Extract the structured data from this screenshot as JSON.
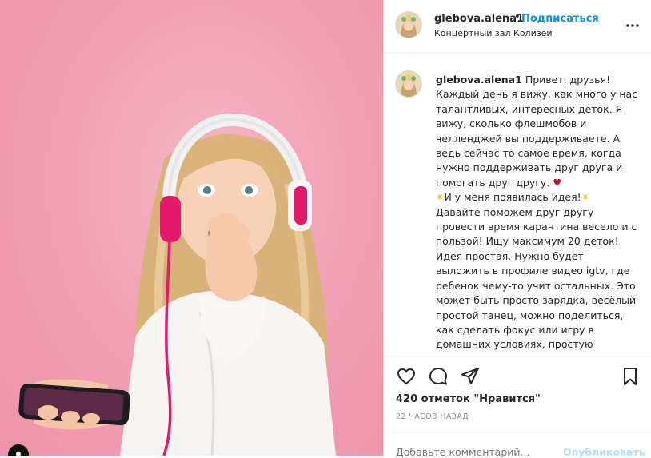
{
  "header": {
    "username": "glebova.alena1",
    "separator": "•",
    "follow_label": "Подписаться",
    "location": "Концертный зал Колизей",
    "more_icon": "more-horizontal-icon"
  },
  "caption": {
    "username": "glebova.alena1",
    "intro": "Привет, друзья!",
    "text_1": "Каждый день я вижу, как много у нас талантливых, интересных деток. Я вижу, сколько флешмобов и челленджей вы поддерживаете. А ведь сейчас то самое время, когда нужно поддерживать друг друга и помогать друг другу.",
    "heart_emoji": "♥",
    "sparkle_emoji": "✷",
    "idea_line": "И у меня появилась идея!",
    "text_2": "Давайте поможем друг другу провести время карантина весело и с пользой! Ищу максимум 20 деток! Идея простая. Нужно будет выложить  в профиле видео igtv, где ребенок чему-то учит остальных. Это может быть просто зарядка, весёлый простой танец, можно поделиться, как сделать фокус или игру в домашних условиях, простую интересную поделку, простое и"
  },
  "actions": {
    "like_icon": "heart-icon",
    "comment_icon": "comment-icon",
    "share_icon": "paper-plane-icon",
    "save_icon": "bookmark-icon"
  },
  "likes_text": "420 отметок \"Нравится\"",
  "timestamp": "22 ЧАСОВ НАЗАД",
  "comment": {
    "placeholder": "Добавьте комментарий...",
    "post_label": "Опубликовать"
  },
  "colors": {
    "accent_blue": "#0095f6",
    "photo_background": "#f2a1b5",
    "heart_red": "#c3102f"
  }
}
